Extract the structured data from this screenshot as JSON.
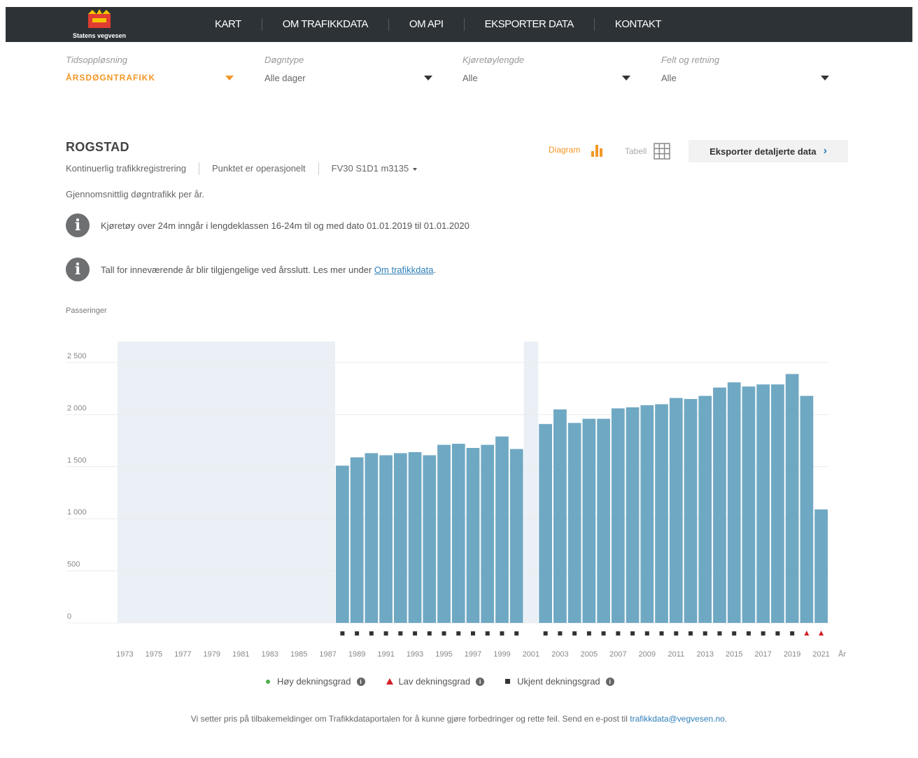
{
  "brand": {
    "name": "Statens vegvesen"
  },
  "nav": {
    "items": [
      "KART",
      "OM TRAFIKKDATA",
      "OM API",
      "EKSPORTER DATA",
      "KONTAKT"
    ]
  },
  "filters": [
    {
      "label": "Tidsoppløsning",
      "value": "ÅRSDØGNTRAFIKK"
    },
    {
      "label": "Døgntype",
      "value": "Alle dager"
    },
    {
      "label": "Kjøretøylengde",
      "value": "Alle"
    },
    {
      "label": "Felt og retning",
      "value": "Alle"
    }
  ],
  "station": {
    "title": "ROGSTAD",
    "meta": [
      "Kontinuerlig trafikkregistrering",
      "Punktet er operasjonelt",
      "FV30 S1D1 m3135"
    ],
    "subtitle": "Gjennomsnittlig døgntrafikk per år."
  },
  "view": {
    "diagram_label": "Diagram",
    "table_label": "Tabell",
    "export_label": "Eksporter detaljerte data"
  },
  "info": [
    {
      "text": "Kjøretøy over 24m inngår i lengdeklassen 16-24m til og med dato 01.01.2019 til 01.01.2020"
    },
    {
      "text_before": "Tall for inneværende år blir tilgjengelige ved årsslutt. Les mer under ",
      "link": "Om trafikkdata",
      "text_after": "."
    }
  ],
  "chart_data": {
    "type": "bar",
    "ylabel": "Passeringer",
    "xlabel": "År",
    "ylim": [
      0,
      2500
    ],
    "yticks": [
      "0",
      "500",
      "1 000",
      "1 500",
      "2 000",
      "2 500"
    ],
    "grid": true,
    "x": [
      1973,
      1974,
      1975,
      1976,
      1977,
      1978,
      1979,
      1980,
      1981,
      1982,
      1983,
      1984,
      1985,
      1986,
      1987,
      1988,
      1989,
      1990,
      1991,
      1992,
      1993,
      1994,
      1995,
      1996,
      1997,
      1998,
      1999,
      2000,
      2001,
      2002,
      2003,
      2004,
      2005,
      2006,
      2007,
      2008,
      2009,
      2010,
      2011,
      2012,
      2013,
      2014,
      2015,
      2016,
      2017,
      2018,
      2019,
      2020,
      2021
    ],
    "xtick_labels": [
      "1973",
      "1975",
      "1977",
      "1979",
      "1981",
      "1983",
      "1985",
      "1987",
      "1989",
      "1991",
      "1993",
      "1995",
      "1997",
      "1999",
      "2001",
      "2003",
      "2005",
      "2007",
      "2009",
      "2011",
      "2013",
      "2015",
      "2017",
      "2019",
      "2021"
    ],
    "values": [
      null,
      null,
      null,
      null,
      null,
      null,
      null,
      null,
      null,
      null,
      null,
      null,
      null,
      null,
      null,
      1510,
      1590,
      1630,
      1610,
      1630,
      1640,
      1610,
      1710,
      1720,
      1680,
      1710,
      1790,
      1670,
      null,
      1910,
      2050,
      1920,
      1960,
      1960,
      2060,
      2070,
      2090,
      2100,
      2160,
      2150,
      2180,
      2260,
      2310,
      2270,
      2290,
      2290,
      2390,
      2180,
      1090
    ],
    "no_data_ranges": [
      [
        1973,
        1987
      ],
      [
        2001,
        2001
      ]
    ],
    "coverage": [
      "none",
      "none",
      "none",
      "none",
      "none",
      "none",
      "none",
      "none",
      "none",
      "none",
      "none",
      "none",
      "none",
      "none",
      "none",
      "unknown",
      "unknown",
      "unknown",
      "unknown",
      "unknown",
      "unknown",
      "unknown",
      "unknown",
      "unknown",
      "unknown",
      "unknown",
      "unknown",
      "unknown",
      "none",
      "unknown",
      "unknown",
      "unknown",
      "unknown",
      "unknown",
      "unknown",
      "unknown",
      "unknown",
      "unknown",
      "unknown",
      "unknown",
      "unknown",
      "unknown",
      "unknown",
      "unknown",
      "unknown",
      "unknown",
      "unknown",
      "low",
      "low"
    ],
    "bar_color": "#6fa8c3",
    "nodata_color": "#eaf0f6"
  },
  "legend": [
    "Høy dekningsgrad",
    "Lav dekningsgrad",
    "Ukjent dekningsgrad"
  ],
  "footer": {
    "text": "Vi setter pris på tilbakemeldinger om Trafikkdataportalen for å kunne gjøre forbedringer og rette feil. Send en e-post til ",
    "email": "trafikkdata@vegvesen.no",
    "end": "."
  }
}
